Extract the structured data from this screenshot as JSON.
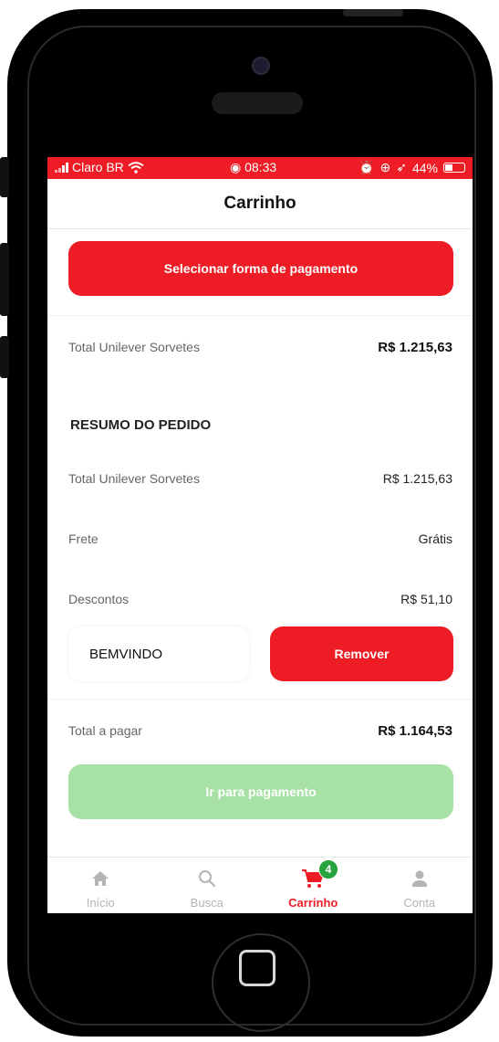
{
  "status_bar": {
    "carrier": "Claro BR",
    "time": "08:33",
    "battery": "44%",
    "battery_level": 0.44,
    "color": "#ee1c24"
  },
  "header": {
    "title": "Carrinho"
  },
  "payment_button": {
    "label": "Selecionar forma de pagamento"
  },
  "store_total": {
    "label": "Total Unilever Sorvetes",
    "value": "R$ 1.215,63"
  },
  "summary": {
    "heading": "RESUMO DO PEDIDO",
    "rows": [
      {
        "label": "Total Unilever Sorvetes",
        "value": "R$ 1.215,63"
      },
      {
        "label": "Frete",
        "value": "Grátis"
      },
      {
        "label": "Descontos",
        "value": "R$ 51,10"
      }
    ]
  },
  "coupon": {
    "code": "BEMVINDO",
    "remove_label": "Remover"
  },
  "total": {
    "label": "Total a pagar",
    "value": "R$ 1.164,53"
  },
  "checkout_button": {
    "label": "Ir para pagamento",
    "color": "#a7e1a5"
  },
  "tab_bar": {
    "tabs": [
      {
        "label": "Início",
        "icon": "home-icon"
      },
      {
        "label": "Busca",
        "icon": "search-icon"
      },
      {
        "label": "Carrinho",
        "icon": "cart-icon",
        "badge": "4",
        "active": true
      },
      {
        "label": "Conta",
        "icon": "user-icon"
      }
    ]
  },
  "colors": {
    "accent": "#ee1c24",
    "badge": "#27a33b"
  }
}
